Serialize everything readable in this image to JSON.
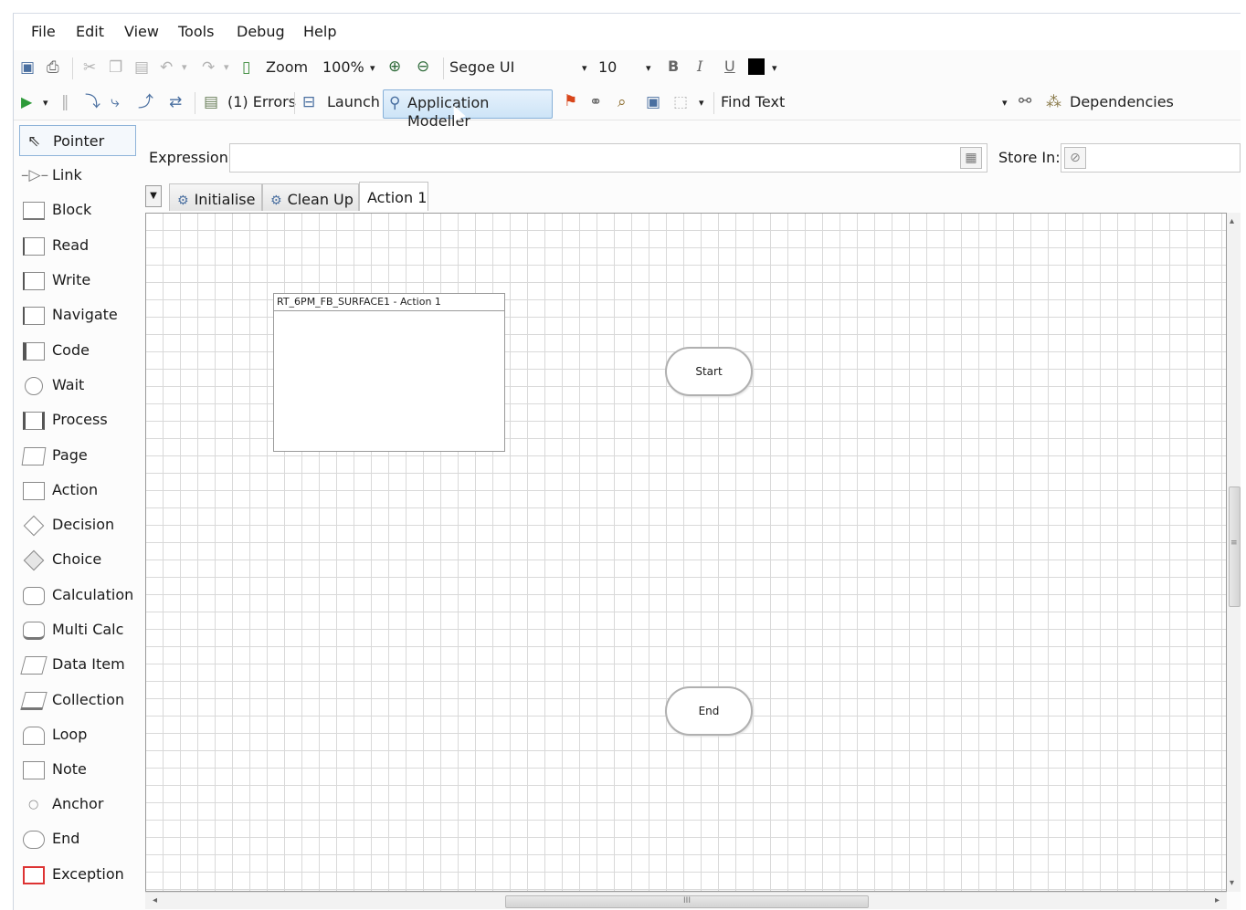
{
  "menu": [
    "File",
    "Edit",
    "View",
    "Tools",
    "Debug",
    "Help"
  ],
  "toolbar1": {
    "zoom_label": "Zoom",
    "zoom_value": "100%",
    "font_name": "Segoe UI",
    "font_size": "10",
    "bold": "B",
    "italic": "I",
    "underline": "U"
  },
  "toolbar2": {
    "errors": "(1) Errors",
    "launch": "Launch",
    "app_modeller": "Application Modeller",
    "find_text": "Find Text",
    "dependencies": "Dependencies"
  },
  "toolbox": [
    "Pointer",
    "Link",
    "Block",
    "Read",
    "Write",
    "Navigate",
    "Code",
    "Wait",
    "Process",
    "Page",
    "Action",
    "Decision",
    "Choice",
    "Calculation",
    "Multi Calc",
    "Data Item",
    "Collection",
    "Loop",
    "Note",
    "Anchor",
    "End",
    "Exception"
  ],
  "expression": {
    "label": "Expression:",
    "value": "",
    "store_label": "Store In:",
    "store_value": ""
  },
  "tabs": [
    "Initialise",
    "Clean Up",
    "Action 1"
  ],
  "canvas": {
    "block_title": "RT_6PM_FB_SURFACE1 - Action 1",
    "start": "Start",
    "end": "End"
  },
  "scroll": {
    "h_grip": "III",
    "v_grip": "≡"
  }
}
